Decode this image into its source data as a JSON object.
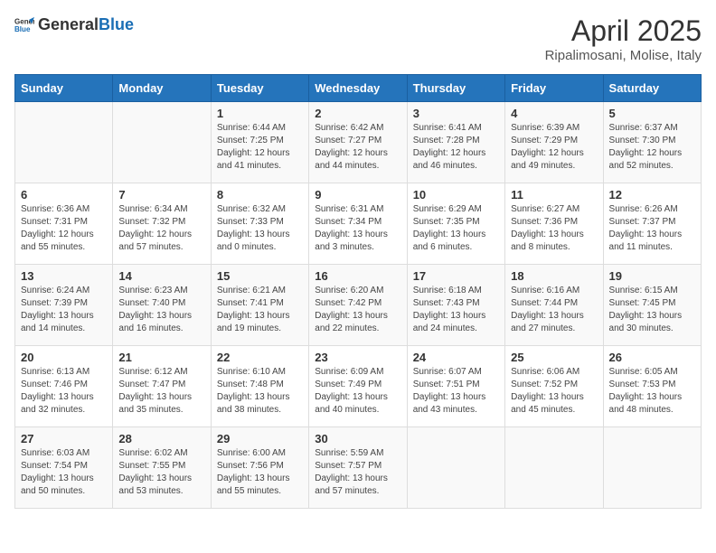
{
  "header": {
    "logo_general": "General",
    "logo_blue": "Blue",
    "title": "April 2025",
    "subtitle": "Ripalimosani, Molise, Italy"
  },
  "days_of_week": [
    "Sunday",
    "Monday",
    "Tuesday",
    "Wednesday",
    "Thursday",
    "Friday",
    "Saturday"
  ],
  "weeks": [
    [
      {
        "day": "",
        "sunrise": "",
        "sunset": "",
        "daylight": ""
      },
      {
        "day": "",
        "sunrise": "",
        "sunset": "",
        "daylight": ""
      },
      {
        "day": "1",
        "sunrise": "Sunrise: 6:44 AM",
        "sunset": "Sunset: 7:25 PM",
        "daylight": "Daylight: 12 hours and 41 minutes."
      },
      {
        "day": "2",
        "sunrise": "Sunrise: 6:42 AM",
        "sunset": "Sunset: 7:27 PM",
        "daylight": "Daylight: 12 hours and 44 minutes."
      },
      {
        "day": "3",
        "sunrise": "Sunrise: 6:41 AM",
        "sunset": "Sunset: 7:28 PM",
        "daylight": "Daylight: 12 hours and 46 minutes."
      },
      {
        "day": "4",
        "sunrise": "Sunrise: 6:39 AM",
        "sunset": "Sunset: 7:29 PM",
        "daylight": "Daylight: 12 hours and 49 minutes."
      },
      {
        "day": "5",
        "sunrise": "Sunrise: 6:37 AM",
        "sunset": "Sunset: 7:30 PM",
        "daylight": "Daylight: 12 hours and 52 minutes."
      }
    ],
    [
      {
        "day": "6",
        "sunrise": "Sunrise: 6:36 AM",
        "sunset": "Sunset: 7:31 PM",
        "daylight": "Daylight: 12 hours and 55 minutes."
      },
      {
        "day": "7",
        "sunrise": "Sunrise: 6:34 AM",
        "sunset": "Sunset: 7:32 PM",
        "daylight": "Daylight: 12 hours and 57 minutes."
      },
      {
        "day": "8",
        "sunrise": "Sunrise: 6:32 AM",
        "sunset": "Sunset: 7:33 PM",
        "daylight": "Daylight: 13 hours and 0 minutes."
      },
      {
        "day": "9",
        "sunrise": "Sunrise: 6:31 AM",
        "sunset": "Sunset: 7:34 PM",
        "daylight": "Daylight: 13 hours and 3 minutes."
      },
      {
        "day": "10",
        "sunrise": "Sunrise: 6:29 AM",
        "sunset": "Sunset: 7:35 PM",
        "daylight": "Daylight: 13 hours and 6 minutes."
      },
      {
        "day": "11",
        "sunrise": "Sunrise: 6:27 AM",
        "sunset": "Sunset: 7:36 PM",
        "daylight": "Daylight: 13 hours and 8 minutes."
      },
      {
        "day": "12",
        "sunrise": "Sunrise: 6:26 AM",
        "sunset": "Sunset: 7:37 PM",
        "daylight": "Daylight: 13 hours and 11 minutes."
      }
    ],
    [
      {
        "day": "13",
        "sunrise": "Sunrise: 6:24 AM",
        "sunset": "Sunset: 7:39 PM",
        "daylight": "Daylight: 13 hours and 14 minutes."
      },
      {
        "day": "14",
        "sunrise": "Sunrise: 6:23 AM",
        "sunset": "Sunset: 7:40 PM",
        "daylight": "Daylight: 13 hours and 16 minutes."
      },
      {
        "day": "15",
        "sunrise": "Sunrise: 6:21 AM",
        "sunset": "Sunset: 7:41 PM",
        "daylight": "Daylight: 13 hours and 19 minutes."
      },
      {
        "day": "16",
        "sunrise": "Sunrise: 6:20 AM",
        "sunset": "Sunset: 7:42 PM",
        "daylight": "Daylight: 13 hours and 22 minutes."
      },
      {
        "day": "17",
        "sunrise": "Sunrise: 6:18 AM",
        "sunset": "Sunset: 7:43 PM",
        "daylight": "Daylight: 13 hours and 24 minutes."
      },
      {
        "day": "18",
        "sunrise": "Sunrise: 6:16 AM",
        "sunset": "Sunset: 7:44 PM",
        "daylight": "Daylight: 13 hours and 27 minutes."
      },
      {
        "day": "19",
        "sunrise": "Sunrise: 6:15 AM",
        "sunset": "Sunset: 7:45 PM",
        "daylight": "Daylight: 13 hours and 30 minutes."
      }
    ],
    [
      {
        "day": "20",
        "sunrise": "Sunrise: 6:13 AM",
        "sunset": "Sunset: 7:46 PM",
        "daylight": "Daylight: 13 hours and 32 minutes."
      },
      {
        "day": "21",
        "sunrise": "Sunrise: 6:12 AM",
        "sunset": "Sunset: 7:47 PM",
        "daylight": "Daylight: 13 hours and 35 minutes."
      },
      {
        "day": "22",
        "sunrise": "Sunrise: 6:10 AM",
        "sunset": "Sunset: 7:48 PM",
        "daylight": "Daylight: 13 hours and 38 minutes."
      },
      {
        "day": "23",
        "sunrise": "Sunrise: 6:09 AM",
        "sunset": "Sunset: 7:49 PM",
        "daylight": "Daylight: 13 hours and 40 minutes."
      },
      {
        "day": "24",
        "sunrise": "Sunrise: 6:07 AM",
        "sunset": "Sunset: 7:51 PM",
        "daylight": "Daylight: 13 hours and 43 minutes."
      },
      {
        "day": "25",
        "sunrise": "Sunrise: 6:06 AM",
        "sunset": "Sunset: 7:52 PM",
        "daylight": "Daylight: 13 hours and 45 minutes."
      },
      {
        "day": "26",
        "sunrise": "Sunrise: 6:05 AM",
        "sunset": "Sunset: 7:53 PM",
        "daylight": "Daylight: 13 hours and 48 minutes."
      }
    ],
    [
      {
        "day": "27",
        "sunrise": "Sunrise: 6:03 AM",
        "sunset": "Sunset: 7:54 PM",
        "daylight": "Daylight: 13 hours and 50 minutes."
      },
      {
        "day": "28",
        "sunrise": "Sunrise: 6:02 AM",
        "sunset": "Sunset: 7:55 PM",
        "daylight": "Daylight: 13 hours and 53 minutes."
      },
      {
        "day": "29",
        "sunrise": "Sunrise: 6:00 AM",
        "sunset": "Sunset: 7:56 PM",
        "daylight": "Daylight: 13 hours and 55 minutes."
      },
      {
        "day": "30",
        "sunrise": "Sunrise: 5:59 AM",
        "sunset": "Sunset: 7:57 PM",
        "daylight": "Daylight: 13 hours and 57 minutes."
      },
      {
        "day": "",
        "sunrise": "",
        "sunset": "",
        "daylight": ""
      },
      {
        "day": "",
        "sunrise": "",
        "sunset": "",
        "daylight": ""
      },
      {
        "day": "",
        "sunrise": "",
        "sunset": "",
        "daylight": ""
      }
    ]
  ]
}
